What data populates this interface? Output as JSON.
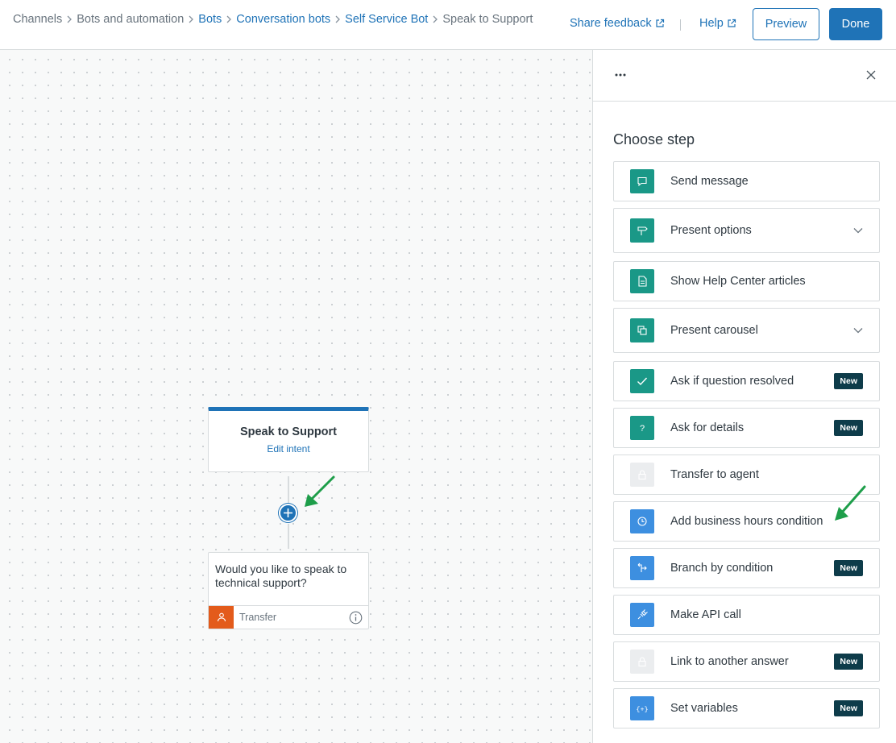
{
  "breadcrumb": {
    "items": [
      "Channels",
      "Bots and automation",
      "Bots",
      "Conversation bots",
      "Self Service Bot",
      "Speak to Support"
    ]
  },
  "header": {
    "share_feedback": "Share feedback",
    "help": "Help",
    "preview": "Preview",
    "done": "Done"
  },
  "canvas": {
    "trigger": {
      "title": "Speak to Support",
      "edit_link": "Edit intent"
    },
    "step": {
      "message": "Would you like to speak to technical support?",
      "type": "Transfer"
    }
  },
  "panel": {
    "title": "Choose step",
    "options": [
      {
        "label": "Send message",
        "icon": "message-icon",
        "new": ""
      },
      {
        "label": "Present options",
        "icon": "signpost-icon",
        "new": ""
      },
      {
        "label": "Show Help Center articles",
        "icon": "article-icon",
        "new": ""
      },
      {
        "label": "Present carousel",
        "icon": "carousel-icon",
        "new": ""
      },
      {
        "label": "Ask if question resolved",
        "icon": "check-icon",
        "new": "New"
      },
      {
        "label": "Ask for details",
        "icon": "question-icon",
        "new": "New"
      },
      {
        "label": "Transfer to agent",
        "icon": "lock-icon",
        "new": ""
      },
      {
        "label": "Add business hours condition",
        "icon": "clock-icon",
        "new": ""
      },
      {
        "label": "Branch by condition",
        "icon": "branch-icon",
        "new": "New"
      },
      {
        "label": "Make API call",
        "icon": "plug-icon",
        "new": ""
      },
      {
        "label": "Link to another answer",
        "icon": "lock-icon",
        "new": "New"
      },
      {
        "label": "Set variables",
        "icon": "variables-icon",
        "new": "New"
      }
    ]
  },
  "colors": {
    "brand_blue": "#1f73b7",
    "step_green": "#1a9887",
    "step_blue": "#3d8fe0",
    "badge_dark": "#0e3c4a",
    "transfer_orange": "#e35b1b",
    "annotation_arrow": "#1e9e4a"
  }
}
